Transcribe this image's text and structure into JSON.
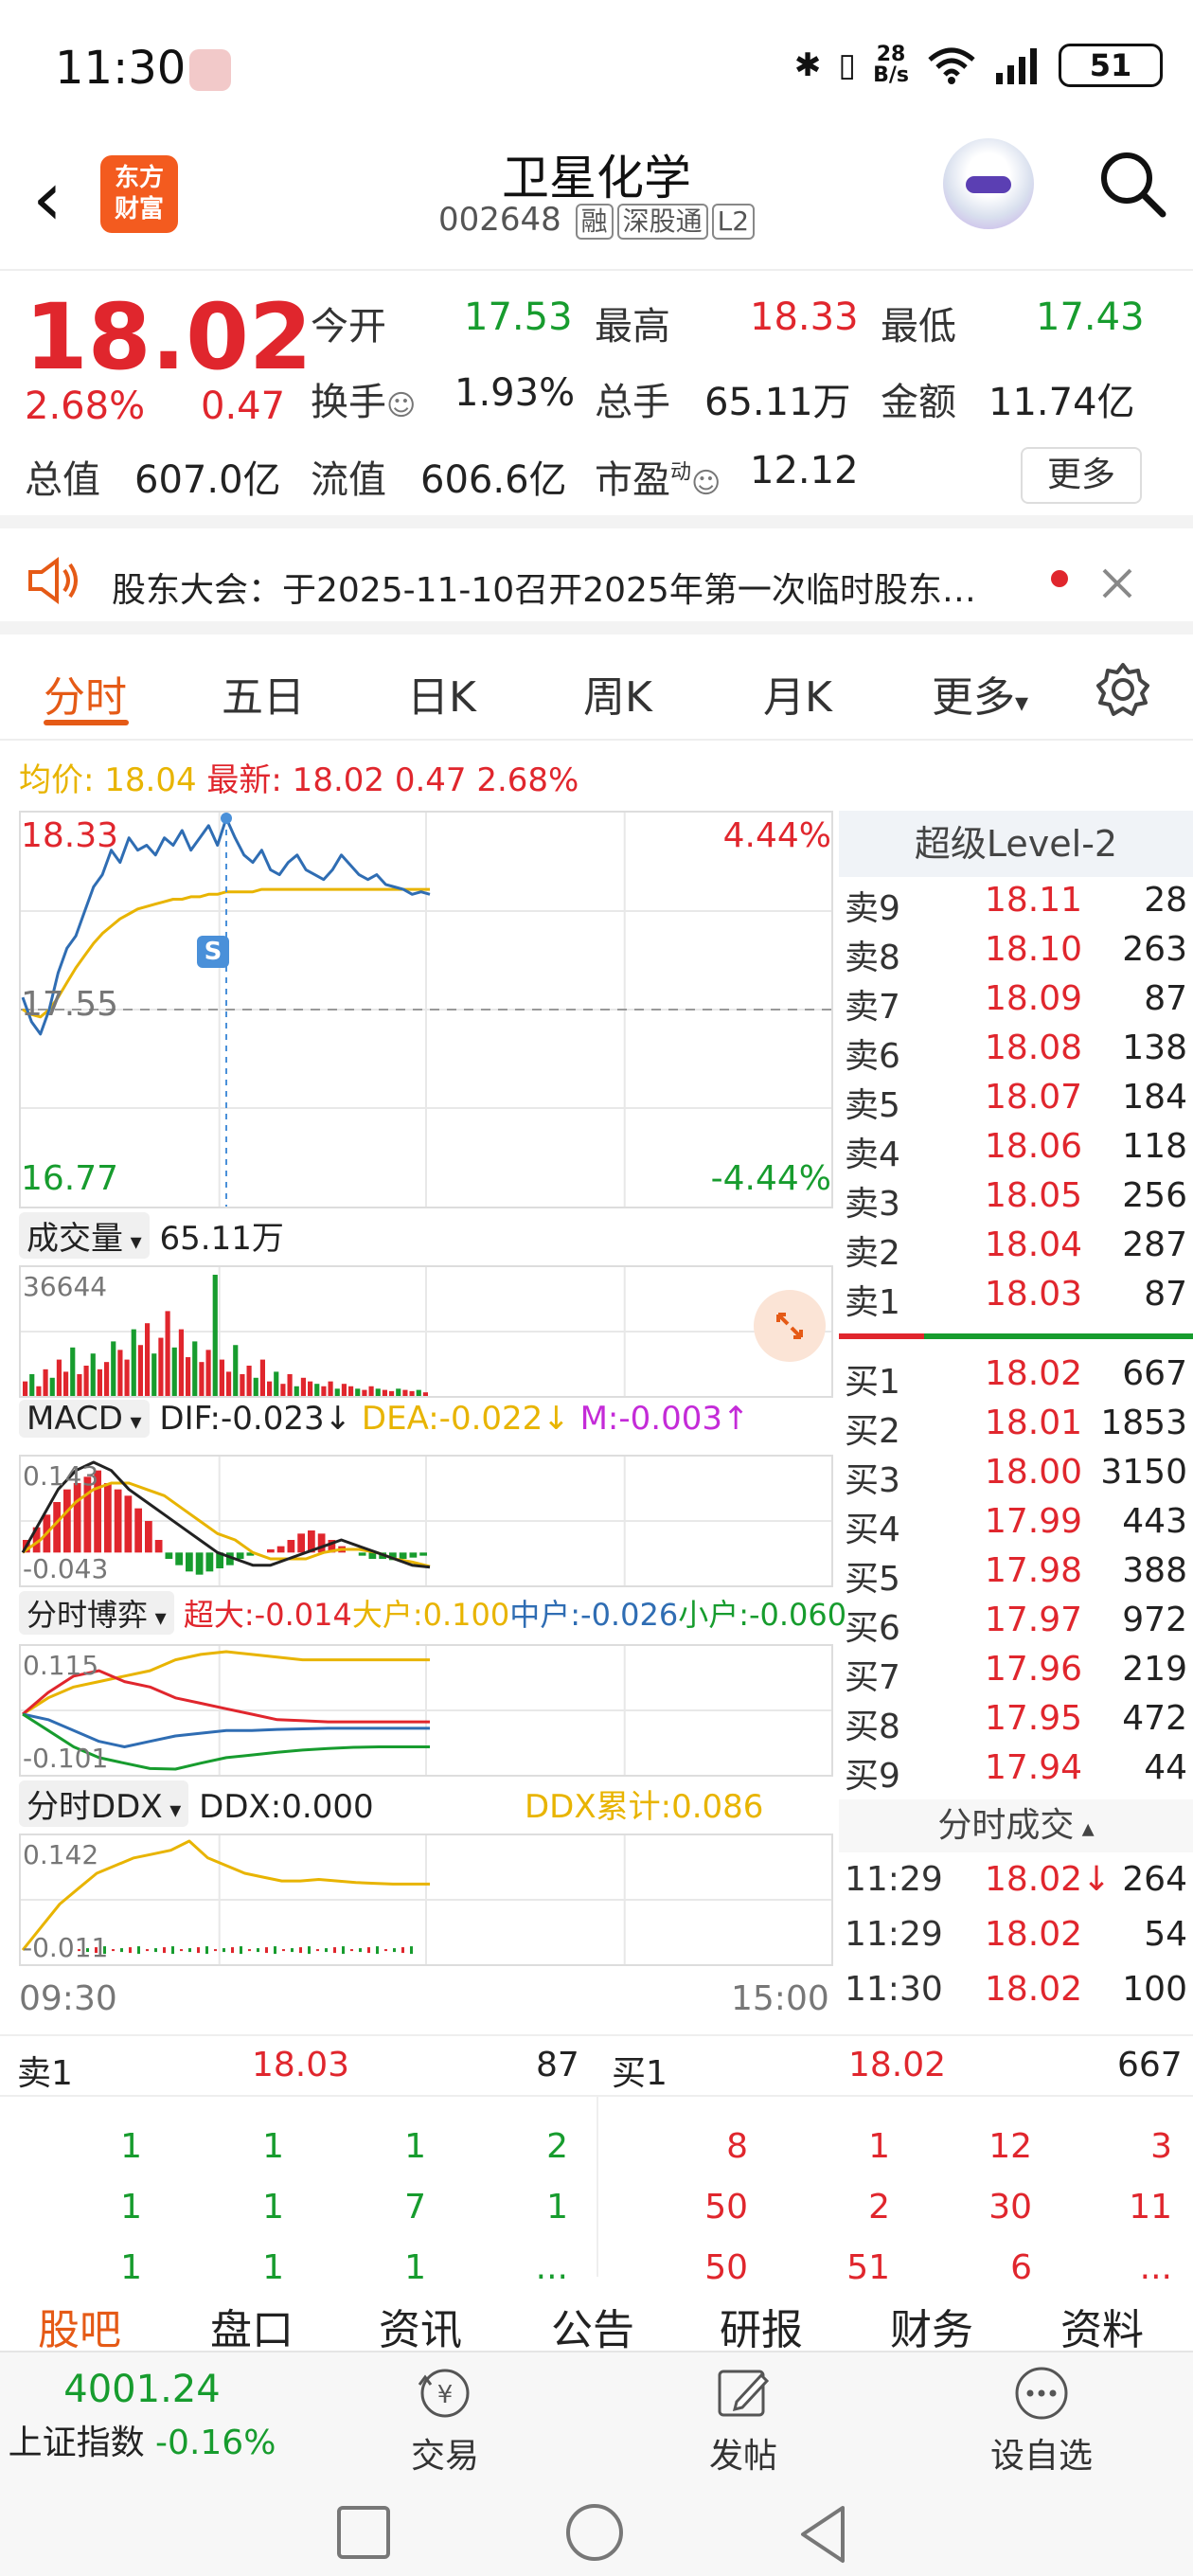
{
  "status": {
    "time": "11:30",
    "net_speed_top": "28",
    "net_speed_bottom": "B/s",
    "battery": "51"
  },
  "header": {
    "logo_line1": "东方",
    "logo_line2": "财富",
    "title": "卫星化学",
    "code": "002648",
    "tags": [
      "融",
      "深股通",
      "L2"
    ]
  },
  "quote": {
    "price": "18.02",
    "change_pct": "2.68%",
    "change": "0.47",
    "rows": [
      [
        {
          "label": "今开",
          "value": "17.53",
          "color": "green"
        },
        {
          "label": "最高",
          "value": "18.33",
          "color": "red"
        },
        {
          "label": "最低",
          "value": "17.43",
          "color": "green"
        }
      ],
      [
        {
          "label": "换手",
          "value": "1.93%",
          "color": "dark"
        },
        {
          "label": "总手",
          "value": "65.11万",
          "color": "dark"
        },
        {
          "label": "金额",
          "value": "11.74亿",
          "color": "dark"
        }
      ],
      [
        {
          "label": "总值",
          "value": "607.0亿",
          "color": "dark"
        },
        {
          "label": "流值",
          "value": "606.6亿",
          "color": "dark"
        },
        {
          "label": "市盈",
          "value": "12.12",
          "color": "dark"
        }
      ]
    ],
    "pe_superscript": "动",
    "more": "更多"
  },
  "notice": {
    "text": "股东大会：于2025-11-10召开2025年第一次临时股东…"
  },
  "tabs": [
    "分时",
    "五日",
    "日K",
    "周K",
    "月K",
    "更多"
  ],
  "avg_bar": {
    "avg_label": "均价: 18.04",
    "latest_label": "最新: 18.02 0.47 2.68%"
  },
  "chart_data": {
    "type": "line",
    "title": "",
    "price_axis": {
      "top": "18.33",
      "mid": "17.55",
      "bottom": "16.77"
    },
    "pct_axis": {
      "top": "4.44%",
      "bottom": "-4.44%"
    },
    "ylim": [
      16.77,
      18.33
    ],
    "time_start": "09:30",
    "time_end": "15:00",
    "series": [
      {
        "values": [
          17.6,
          17.5,
          17.45,
          17.55,
          17.7,
          17.8,
          17.85,
          17.95,
          18.05,
          18.1,
          18.2,
          18.15,
          18.25,
          18.2,
          18.22,
          18.18,
          18.25,
          18.22,
          18.28,
          18.2,
          18.25,
          18.3,
          18.22,
          18.33,
          18.25,
          18.18,
          18.15,
          18.2,
          18.12,
          18.1,
          18.15,
          18.18,
          18.12,
          18.1,
          18.08,
          18.12,
          18.18,
          18.14,
          18.1,
          18.08,
          18.1,
          18.06,
          18.05,
          18.04,
          18.02,
          18.03,
          18.02
        ]
      },
      {
        "values": [
          17.55,
          17.53,
          17.52,
          17.55,
          17.6,
          17.66,
          17.72,
          17.77,
          17.82,
          17.86,
          17.89,
          17.92,
          17.94,
          17.96,
          17.97,
          17.98,
          17.99,
          18.0,
          18.0,
          18.01,
          18.01,
          18.02,
          18.02,
          18.03,
          18.03,
          18.03,
          18.03,
          18.04,
          18.04,
          18.04,
          18.04,
          18.04,
          18.04,
          18.04,
          18.04,
          18.04,
          18.04,
          18.04,
          18.04,
          18.04,
          18.04,
          18.04,
          18.04,
          18.04,
          18.04,
          18.04,
          18.04
        ]
      }
    ]
  },
  "volume": {
    "label": "成交量",
    "total": "65.11万",
    "max": "36644",
    "bars": [
      12,
      18,
      8,
      22,
      15,
      30,
      20,
      40,
      18,
      25,
      35,
      22,
      28,
      45,
      38,
      30,
      55,
      42,
      60,
      35,
      48,
      70,
      40,
      55,
      32,
      45,
      28,
      38,
      100,
      30,
      20,
      42,
      18,
      25,
      15,
      30,
      12,
      20,
      10,
      18,
      8,
      15,
      12,
      10,
      8,
      12,
      6,
      10,
      8,
      6,
      5,
      8,
      6,
      5,
      4,
      6,
      5,
      4,
      5,
      3
    ]
  },
  "macd": {
    "label": "MACD",
    "dif": "DIF:-0.023↓",
    "dea": "DEA:-0.022↓",
    "m": "M:-0.003↑",
    "top": "0.143",
    "bottom": "-0.043",
    "bars": [
      0.02,
      0.04,
      0.06,
      0.08,
      0.1,
      0.11,
      0.12,
      0.13,
      0.11,
      0.1,
      0.09,
      0.07,
      0.05,
      0.02,
      -0.01,
      -0.02,
      -0.03,
      -0.035,
      -0.03,
      -0.025,
      -0.02,
      -0.01,
      -0.005,
      0.0,
      0.005,
      0.01,
      0.02,
      0.03,
      0.035,
      0.03,
      0.02,
      0.01,
      0.0,
      -0.005,
      -0.01,
      -0.01,
      -0.012,
      -0.01,
      -0.008,
      -0.005
    ],
    "dif_line": [
      0.0,
      0.05,
      0.1,
      0.13,
      0.143,
      0.13,
      0.1,
      0.08,
      0.06,
      0.04,
      0.02,
      0.0,
      -0.01,
      -0.02,
      -0.02,
      -0.01,
      0.0,
      0.01,
      0.02,
      0.01,
      0.0,
      -0.01,
      -0.02,
      -0.023
    ],
    "dea_line": [
      0.0,
      0.02,
      0.05,
      0.08,
      0.1,
      0.11,
      0.11,
      0.1,
      0.09,
      0.07,
      0.05,
      0.03,
      0.02,
      0.0,
      -0.01,
      -0.01,
      -0.01,
      0.0,
      0.005,
      0.005,
      0.0,
      -0.01,
      -0.015,
      -0.022
    ]
  },
  "game": {
    "label": "分时博弈",
    "super": "超大:-0.014",
    "large": "大户:0.100",
    "mid": "中户:-0.026",
    "small": "小户:-0.060",
    "top": "0.115",
    "bottom": "-0.101",
    "yellow": [
      0.0,
      0.03,
      0.05,
      0.06,
      0.07,
      0.08,
      0.1,
      0.11,
      0.115,
      0.11,
      0.105,
      0.1,
      0.1,
      0.1,
      0.1,
      0.1,
      0.1
    ],
    "red": [
      0.0,
      0.04,
      0.07,
      0.08,
      0.06,
      0.05,
      0.03,
      0.02,
      0.01,
      0.0,
      -0.01,
      -0.012,
      -0.014,
      -0.014,
      -0.014,
      -0.014,
      -0.014
    ],
    "blue": [
      0.0,
      -0.01,
      -0.03,
      -0.05,
      -0.06,
      -0.05,
      -0.04,
      -0.035,
      -0.03,
      -0.03,
      -0.028,
      -0.027,
      -0.026,
      -0.026,
      -0.026,
      -0.026,
      -0.026
    ],
    "green": [
      0.0,
      -0.03,
      -0.06,
      -0.08,
      -0.09,
      -0.1,
      -0.101,
      -0.09,
      -0.08,
      -0.075,
      -0.07,
      -0.066,
      -0.063,
      -0.061,
      -0.06,
      -0.06,
      -0.06
    ]
  },
  "ddx": {
    "label": "分时DDX",
    "value": "DDX:0.000",
    "cum": "DDX累计:0.086",
    "top": "0.142",
    "bottom": "-0.011",
    "line": [
      0.0,
      0.03,
      0.06,
      0.08,
      0.1,
      0.11,
      0.12,
      0.125,
      0.13,
      0.142,
      0.12,
      0.11,
      0.1,
      0.095,
      0.09,
      0.09,
      0.092,
      0.09,
      0.088,
      0.087,
      0.086,
      0.086,
      0.086
    ],
    "time_start": "09:30",
    "time_end": "15:00"
  },
  "book": {
    "title": "超级Level-2",
    "asks": [
      {
        "k": "卖9",
        "p": "18.11",
        "v": "28"
      },
      {
        "k": "卖8",
        "p": "18.10",
        "v": "263"
      },
      {
        "k": "卖7",
        "p": "18.09",
        "v": "87"
      },
      {
        "k": "卖6",
        "p": "18.08",
        "v": "138"
      },
      {
        "k": "卖5",
        "p": "18.07",
        "v": "184"
      },
      {
        "k": "卖4",
        "p": "18.06",
        "v": "118"
      },
      {
        "k": "卖3",
        "p": "18.05",
        "v": "256"
      },
      {
        "k": "卖2",
        "p": "18.04",
        "v": "287"
      },
      {
        "k": "卖1",
        "p": "18.03",
        "v": "87"
      }
    ],
    "bids": [
      {
        "k": "买1",
        "p": "18.02",
        "v": "667"
      },
      {
        "k": "买2",
        "p": "18.01",
        "v": "1853"
      },
      {
        "k": "买3",
        "p": "18.00",
        "v": "3150"
      },
      {
        "k": "买4",
        "p": "17.99",
        "v": "443"
      },
      {
        "k": "买5",
        "p": "17.98",
        "v": "388"
      },
      {
        "k": "买6",
        "p": "17.97",
        "v": "972"
      },
      {
        "k": "买7",
        "p": "17.96",
        "v": "219"
      },
      {
        "k": "买8",
        "p": "17.95",
        "v": "472"
      },
      {
        "k": "买9",
        "p": "17.94",
        "v": "44"
      }
    ],
    "ticks_title": "分时成交",
    "ticks": [
      {
        "t": "11:29",
        "p": "18.02↓",
        "v": "264",
        "color": "green"
      },
      {
        "t": "11:29",
        "p": "18.02",
        "v": "54",
        "color": "green"
      },
      {
        "t": "11:30",
        "p": "18.02",
        "v": "100",
        "color": "green"
      }
    ]
  },
  "queue": {
    "ask_label": "卖1",
    "ask_price": "18.03",
    "ask_total": "87",
    "bid_label": "买1",
    "bid_price": "18.02",
    "bid_total": "667",
    "ask_rows": [
      [
        "1",
        "1",
        "1",
        "2"
      ],
      [
        "1",
        "1",
        "7",
        "1"
      ],
      [
        "1",
        "1",
        "1",
        "..."
      ]
    ],
    "bid_rows": [
      [
        "8",
        "1",
        "12",
        "3"
      ],
      [
        "50",
        "2",
        "30",
        "11"
      ],
      [
        "50",
        "51",
        "6",
        "..."
      ]
    ]
  },
  "bottom_tabs": [
    "股吧",
    "盘口",
    "资讯",
    "公告",
    "研报",
    "财务",
    "资料"
  ],
  "nav": {
    "index_value": "4001.24",
    "index_name": "上证指数",
    "index_change": "-0.16%",
    "trade": "交易",
    "post": "发帖",
    "watch": "设自选"
  },
  "colors": {
    "up": "#e0262d",
    "down": "#179c2e",
    "accent": "#e55a16",
    "avg": "#e8b400",
    "price_line": "#2f6db3"
  }
}
